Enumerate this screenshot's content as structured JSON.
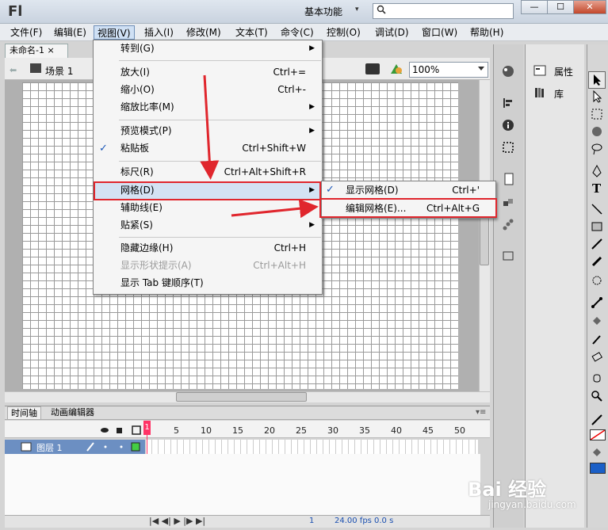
{
  "app": {
    "logo": "Fl",
    "workspace": "基本功能",
    "workspace_arrow": "▾"
  },
  "window_buttons": {
    "minimize": "—",
    "maximize": "☐",
    "close": "✕"
  },
  "menubar": [
    "文件(F)",
    "编辑(E)",
    "视图(V)",
    "插入(I)",
    "修改(M)",
    "文本(T)",
    "命令(C)",
    "控制(O)",
    "调试(D)",
    "窗口(W)",
    "帮助(H)"
  ],
  "document": {
    "tab": "未命名-1 ×",
    "scene": "场景 1",
    "zoom": "100%"
  },
  "view_menu": {
    "goto": "转到(G)",
    "zoom_in": "放大(I)",
    "zoom_in_sc": "Ctrl+=",
    "zoom_out": "缩小(O)",
    "zoom_out_sc": "Ctrl+-",
    "magnification": "缩放比率(M)",
    "preview_mode": "预览模式(P)",
    "pasteboard": "粘贴板",
    "pasteboard_sc": "Ctrl+Shift+W",
    "rulers": "标尺(R)",
    "rulers_sc": "Ctrl+Alt+Shift+R",
    "grid": "网格(D)",
    "guides": "辅助线(E)",
    "snapping": "贴紧(S)",
    "hide_edges": "隐藏边缘(H)",
    "hide_edges_sc": "Ctrl+H",
    "show_shape_hints": "显示形状提示(A)",
    "show_shape_hints_sc": "Ctrl+Alt+H",
    "show_tab_order": "显示 Tab 键顺序(T)"
  },
  "grid_submenu": {
    "show_grid": "显示网格(D)",
    "show_grid_sc": "Ctrl+'",
    "edit_grid": "编辑网格(E)...",
    "edit_grid_sc": "Ctrl+Alt+G"
  },
  "timeline": {
    "tab_timeline": "时间轴",
    "tab_motion": "动画编辑器",
    "ticks": [
      "1",
      "5",
      "10",
      "15",
      "20",
      "25",
      "30",
      "35",
      "40",
      "45",
      "50"
    ],
    "layer_name": "图层 1",
    "fps": "24.00 fps",
    "time": "0.0 s",
    "frame": "1"
  },
  "panels": {
    "properties": "属性",
    "library": "库"
  },
  "watermark": {
    "brand": "Bai 经验",
    "url": "jingyan.baidu.com"
  }
}
